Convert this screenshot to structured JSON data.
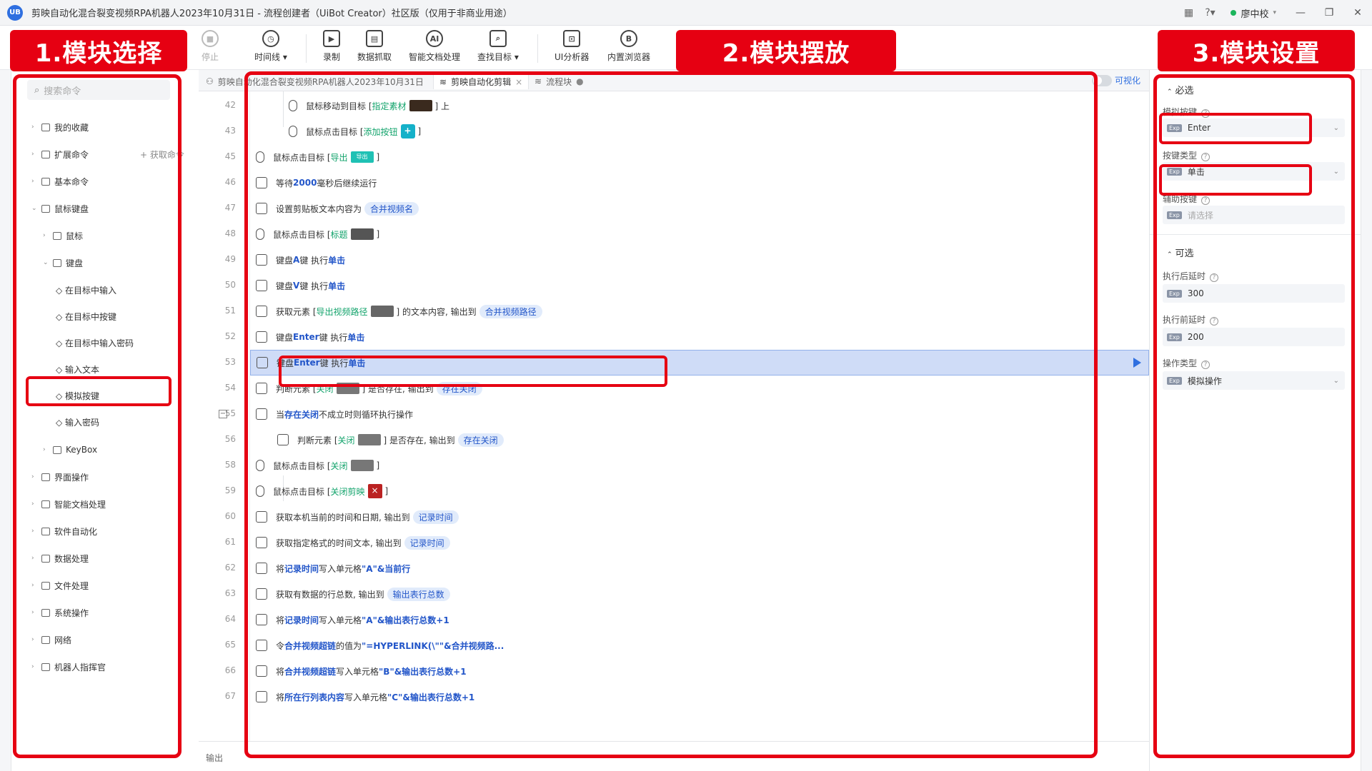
{
  "window": {
    "title": "剪映自动化混合裂变视频RPA机器人2023年10月31日 - 流程创建者（UiBot Creator）社区版（仅用于非商业用途）",
    "logo": "UB",
    "user": "廖中校"
  },
  "toolbar": {
    "stop": "停止",
    "timeline": "时间线 ▾",
    "record": "录制",
    "data_scrape": "数据抓取",
    "smart_doc": "智能文档处理",
    "find_target": "查找目标 ▾",
    "ui_analyzer": "UI分析器",
    "browser": "内置浏览器"
  },
  "annotations": {
    "a1": "1.模块选择",
    "a2": "2.模块摆放",
    "a3": "3.模块设置"
  },
  "left": {
    "search_placeholder": "搜索命令",
    "get_command": "+ 获取命令",
    "tree": [
      {
        "label": "我的收藏",
        "arrow": "›"
      },
      {
        "label": "扩展命令",
        "arrow": "›"
      },
      {
        "label": "基本命令",
        "arrow": "›"
      },
      {
        "label": "鼠标键盘",
        "arrow": "⌄"
      },
      {
        "label": "鼠标",
        "arrow": "›"
      },
      {
        "label": "键盘",
        "arrow": "⌄"
      },
      {
        "label": "◇ 在目标中输入",
        "arrow": ""
      },
      {
        "label": "◇ 在目标中按键",
        "arrow": ""
      },
      {
        "label": "◇ 在目标中输入密码",
        "arrow": ""
      },
      {
        "label": "◇ 输入文本",
        "arrow": ""
      },
      {
        "label": "◇ 模拟按键",
        "arrow": ""
      },
      {
        "label": "◇ 输入密码",
        "arrow": ""
      },
      {
        "label": "KeyBox",
        "arrow": "›"
      },
      {
        "label": "界面操作",
        "arrow": "›"
      },
      {
        "label": "智能文档处理",
        "arrow": "›"
      },
      {
        "label": "软件自动化",
        "arrow": "›"
      },
      {
        "label": "数据处理",
        "arrow": "›"
      },
      {
        "label": "文件处理",
        "arrow": "›"
      },
      {
        "label": "系统操作",
        "arrow": "›"
      },
      {
        "label": "网络",
        "arrow": "›"
      },
      {
        "label": "机器人指挥官",
        "arrow": "›"
      }
    ]
  },
  "tabs": {
    "t1": "剪映自动化混合裂变视频RPA机器人2023年10月31日",
    "t2": "剪映自动化剪辑",
    "t3": "流程块",
    "visual": "可视化"
  },
  "lines": [
    {
      "no": "42",
      "a": "鼠标移动到目标 [ ",
      "b": "指定素材",
      "c": " ] 上"
    },
    {
      "no": "43",
      "a": "鼠标点击目标 [ ",
      "b": "添加按钮",
      "c": " ]"
    },
    {
      "no": "45",
      "a": "鼠标点击目标 [ ",
      "b": "导出",
      "c": " ]"
    },
    {
      "no": "46",
      "a": "等待 ",
      "b": "2000",
      "c": " 毫秒后继续运行"
    },
    {
      "no": "47",
      "a": "设置剪贴板文本内容为 ",
      "b": "合并视频名",
      "c": ""
    },
    {
      "no": "48",
      "a": "鼠标点击目标 [ ",
      "b": "标题",
      "c": " ]"
    },
    {
      "no": "49",
      "a": "键盘 ",
      "b": "A",
      "c": " 键 执行 ",
      "d": "单击"
    },
    {
      "no": "50",
      "a": "键盘 ",
      "b": "V",
      "c": " 键 执行 ",
      "d": "单击"
    },
    {
      "no": "51",
      "a": "获取元素 [ ",
      "b": "导出视频路径",
      "c": " ] 的文本内容, 输出到 ",
      "d": "合并视频路径"
    },
    {
      "no": "52",
      "a": "键盘 ",
      "b": "Enter",
      "c": " 键 执行 ",
      "d": "单击"
    },
    {
      "no": "53",
      "a": "键盘 ",
      "b": "Enter",
      "c": " 键 执行 ",
      "d": "单击"
    },
    {
      "no": "54",
      "a": "判断元素 [ ",
      "b": "关闭",
      "c": " ] 是否存在, 输出到 ",
      "d": "存在关闭"
    },
    {
      "no": "55",
      "a": "当 ",
      "b": "存在关闭",
      "c": " 不成立时则循环执行操作"
    },
    {
      "no": "56",
      "a": "判断元素 [ ",
      "b": "关闭",
      "c": " ] 是否存在, 输出到 ",
      "d": "存在关闭"
    },
    {
      "no": "58",
      "a": "鼠标点击目标 [ ",
      "b": "关闭",
      "c": " ]"
    },
    {
      "no": "59",
      "a": "鼠标点击目标 [ ",
      "b": "关闭剪映",
      "c": " ]"
    },
    {
      "no": "60",
      "a": "获取本机当前的时间和日期, 输出到 ",
      "b": "记录时间",
      "c": ""
    },
    {
      "no": "61",
      "a": "获取指定格式的时间文本, 输出到 ",
      "b": "记录时间",
      "c": ""
    },
    {
      "no": "62",
      "a": "将 ",
      "b": "记录时间",
      "c": " 写入单元格 ",
      "d": "\"A\"&当前行"
    },
    {
      "no": "63",
      "a": "获取有数据的行总数, 输出到 ",
      "b": "输出表行总数",
      "c": ""
    },
    {
      "no": "64",
      "a": "将 ",
      "b": "记录时间",
      "c": " 写入单元格 ",
      "d": "\"A\"&输出表行总数+1"
    },
    {
      "no": "65",
      "a": "令 ",
      "b": "合并视频超链",
      "c": " 的值为 ",
      "d": "\"=HYPERLINK(\\\"\"&合并视频路..."
    },
    {
      "no": "66",
      "a": "将 ",
      "b": "合并视频超链",
      "c": " 写入单元格 ",
      "d": "\"B\"&输出表行总数+1"
    },
    {
      "no": "67",
      "a": "将 ",
      "b": "所在行列表内容",
      "c": " 写入单元格 ",
      "d": "\"C\"&输出表行总数+1"
    }
  ],
  "thumbs": {
    "export_badge": "导出"
  },
  "output_label": "输出",
  "props": {
    "required": "必选",
    "key_label": "模拟按键",
    "key_value": "Enter",
    "keytype_label": "按键类型",
    "keytype_value": "单击",
    "aux_label": "辅助按键",
    "aux_placeholder": "请选择",
    "optional": "可选",
    "delay_after_label": "执行后延时",
    "delay_after": "300",
    "delay_before_label": "执行前延时",
    "delay_before": "200",
    "optype_label": "操作类型",
    "optype_value": "模拟操作",
    "exp": "Exp"
  },
  "colors": {
    "annotation": "#e60012",
    "accent": "#2f6fe0",
    "selected_row": "#cfdcf7"
  }
}
